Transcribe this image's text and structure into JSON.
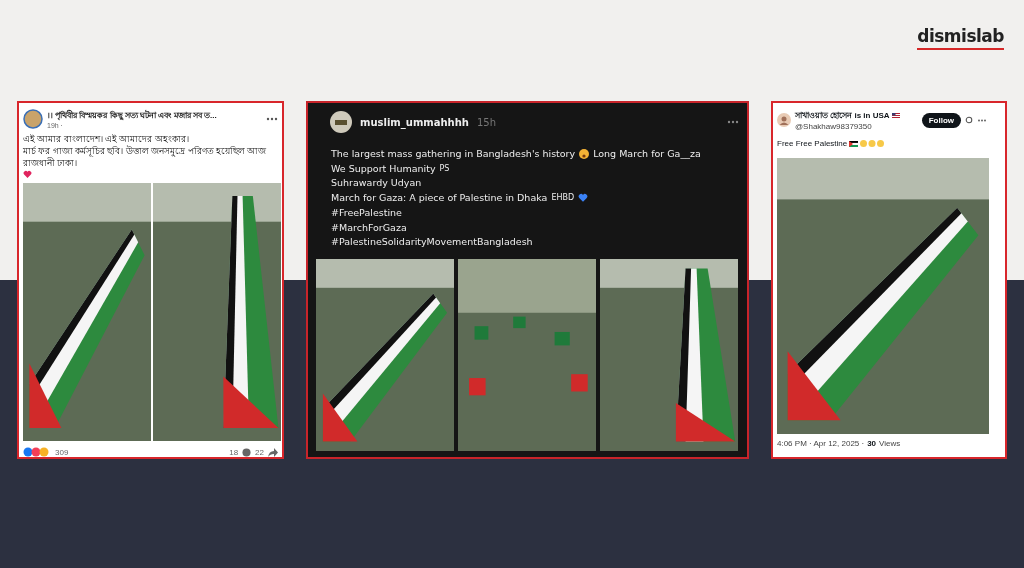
{
  "logo": {
    "text": "dismislab"
  },
  "facebook_post": {
    "page_name": "।। পৃথিবীর বিস্ময়কর কিছু সত্য ঘটনা এবং মজার সব ত...",
    "time": "19h ·",
    "lines": [
      "এই আমার বাংলাদেশ। এই আমাদের অহংকার।",
      "মার্চ ফর গাজা কর্মসূচির ছবি। উত্তাল জনসমুদ্রে পরিণত হয়েছিল আজ রাজধানী ঢাকা।"
    ],
    "reaction_count": "309",
    "comments": "18",
    "shares": "22"
  },
  "threads_post": {
    "username": "muslim_ummahhhh",
    "time": "15h",
    "lines": [
      [
        {
          "kind": "text",
          "text": "The largest mass gathering in Bangladesh's history"
        },
        {
          "kind": "emoji"
        },
        {
          "kind": "text",
          "text": "Long March for Ga__za"
        }
      ],
      [
        {
          "kind": "text",
          "text": "We Support Humanity"
        },
        {
          "kind": "small",
          "text": "PS"
        }
      ],
      [
        {
          "kind": "text",
          "text": "Suhrawardy Udyan"
        }
      ],
      [
        {
          "kind": "text",
          "text": "March for Gaza: A piece of Palestine in Dhaka"
        },
        {
          "kind": "small",
          "text": "EHBD"
        },
        {
          "kind": "heart",
          "color": "#3b82f6"
        }
      ],
      [
        {
          "kind": "text",
          "text": "#FreePalestine"
        }
      ],
      [
        {
          "kind": "text",
          "text": "#MarchForGaza"
        }
      ],
      [
        {
          "kind": "text",
          "text": "#PalestineSolidarityMovementBangladesh"
        }
      ]
    ]
  },
  "x_post": {
    "name": "সাখাওয়াত হোসেন is in USA",
    "handle": "@Shakhaw98379350",
    "follow": "Follow",
    "text": "Free Free Palestine",
    "time": "4:06 PM · Apr 12, 2025 ·",
    "views_count": "30",
    "views_label": "Views"
  }
}
